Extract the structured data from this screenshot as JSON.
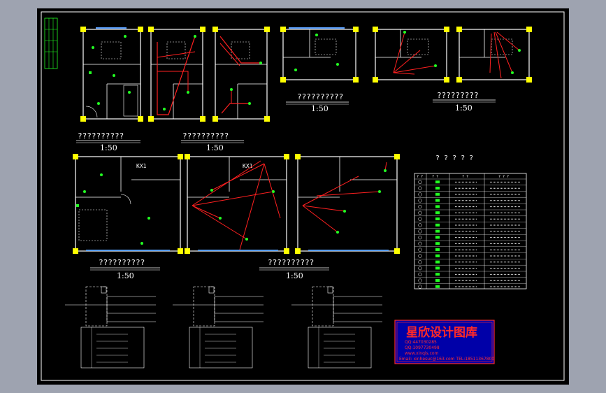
{
  "plans": {
    "top_left_caption_1": "??????????",
    "top_left_caption_2": "??????????",
    "top_left_scale_1": "1:50",
    "top_left_scale_2": "1:50",
    "top_right_caption_1": "??????????",
    "top_right_caption_2": "?????????",
    "top_right_scale_1": "1:50",
    "top_right_scale_2": "1:50",
    "middle_caption_1": "??????????",
    "middle_caption_2": "??????????",
    "middle_scale_1": "1:50",
    "middle_scale_2": "1:50",
    "room_tag_1": "KX1",
    "room_tag_2": "KX1"
  },
  "legend": {
    "title": "? ? ? ? ?",
    "header": [
      "? ?",
      "? ?",
      "? ?",
      "? ? ?"
    ]
  },
  "watermark": {
    "title": "星欣设计图库",
    "line1": "QQ:447030285",
    "line2": "QQ:1097730498",
    "line3": "www.xinqis.com",
    "line4": "Email: xinhesuc@163.com  TEL:18511367800"
  },
  "colors": {
    "sheet": "#000000",
    "frame": "#ffffff",
    "wall": "#ffffff",
    "wire": "#ff2020",
    "fixture": "#22ff22",
    "column": "#ffff00",
    "window": "#5aa0ff",
    "watermark_bg": "#0000a8",
    "watermark_text": "#ff2a2a"
  }
}
